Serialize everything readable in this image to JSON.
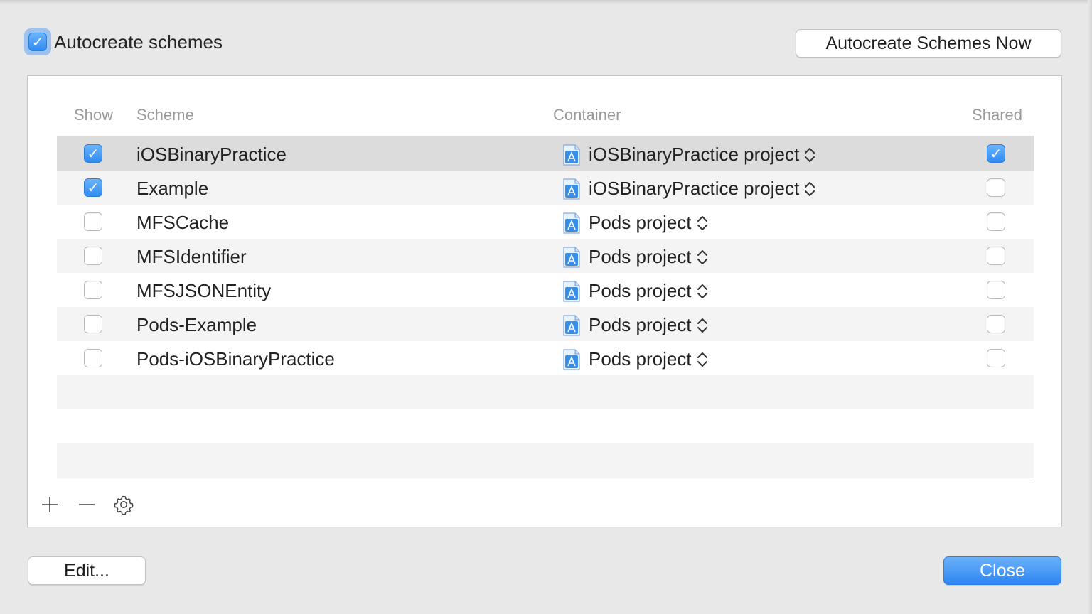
{
  "header": {
    "autocreate_label": "Autocreate schemes",
    "autocreate_checked": true,
    "autocreate_now_label": "Autocreate Schemes Now"
  },
  "table": {
    "columns": {
      "show": "Show",
      "scheme": "Scheme",
      "container": "Container",
      "shared": "Shared"
    },
    "rows": [
      {
        "show": true,
        "scheme": "iOSBinaryPractice",
        "container": "iOSBinaryPractice project",
        "shared": true,
        "selected": true
      },
      {
        "show": true,
        "scheme": "Example",
        "container": "iOSBinaryPractice project",
        "shared": false,
        "selected": false
      },
      {
        "show": false,
        "scheme": "MFSCache",
        "container": "Pods project",
        "shared": false,
        "selected": false
      },
      {
        "show": false,
        "scheme": "MFSIdentifier",
        "container": "Pods project",
        "shared": false,
        "selected": false
      },
      {
        "show": false,
        "scheme": "MFSJSONEntity",
        "container": "Pods project",
        "shared": false,
        "selected": false
      },
      {
        "show": false,
        "scheme": "Pods-Example",
        "container": "Pods project",
        "shared": false,
        "selected": false
      },
      {
        "show": false,
        "scheme": "Pods-iOSBinaryPractice",
        "container": "Pods project",
        "shared": false,
        "selected": false
      }
    ]
  },
  "toolbar": {
    "add_icon": "plus-icon",
    "remove_icon": "minus-icon",
    "settings_icon": "gear-icon"
  },
  "footer": {
    "edit_label": "Edit...",
    "close_label": "Close"
  },
  "colors": {
    "accent": "#2f8cf2",
    "selected_row": "#dcdcdc",
    "alt_row": "#f4f4f4",
    "window_bg": "#e8e8e8"
  }
}
